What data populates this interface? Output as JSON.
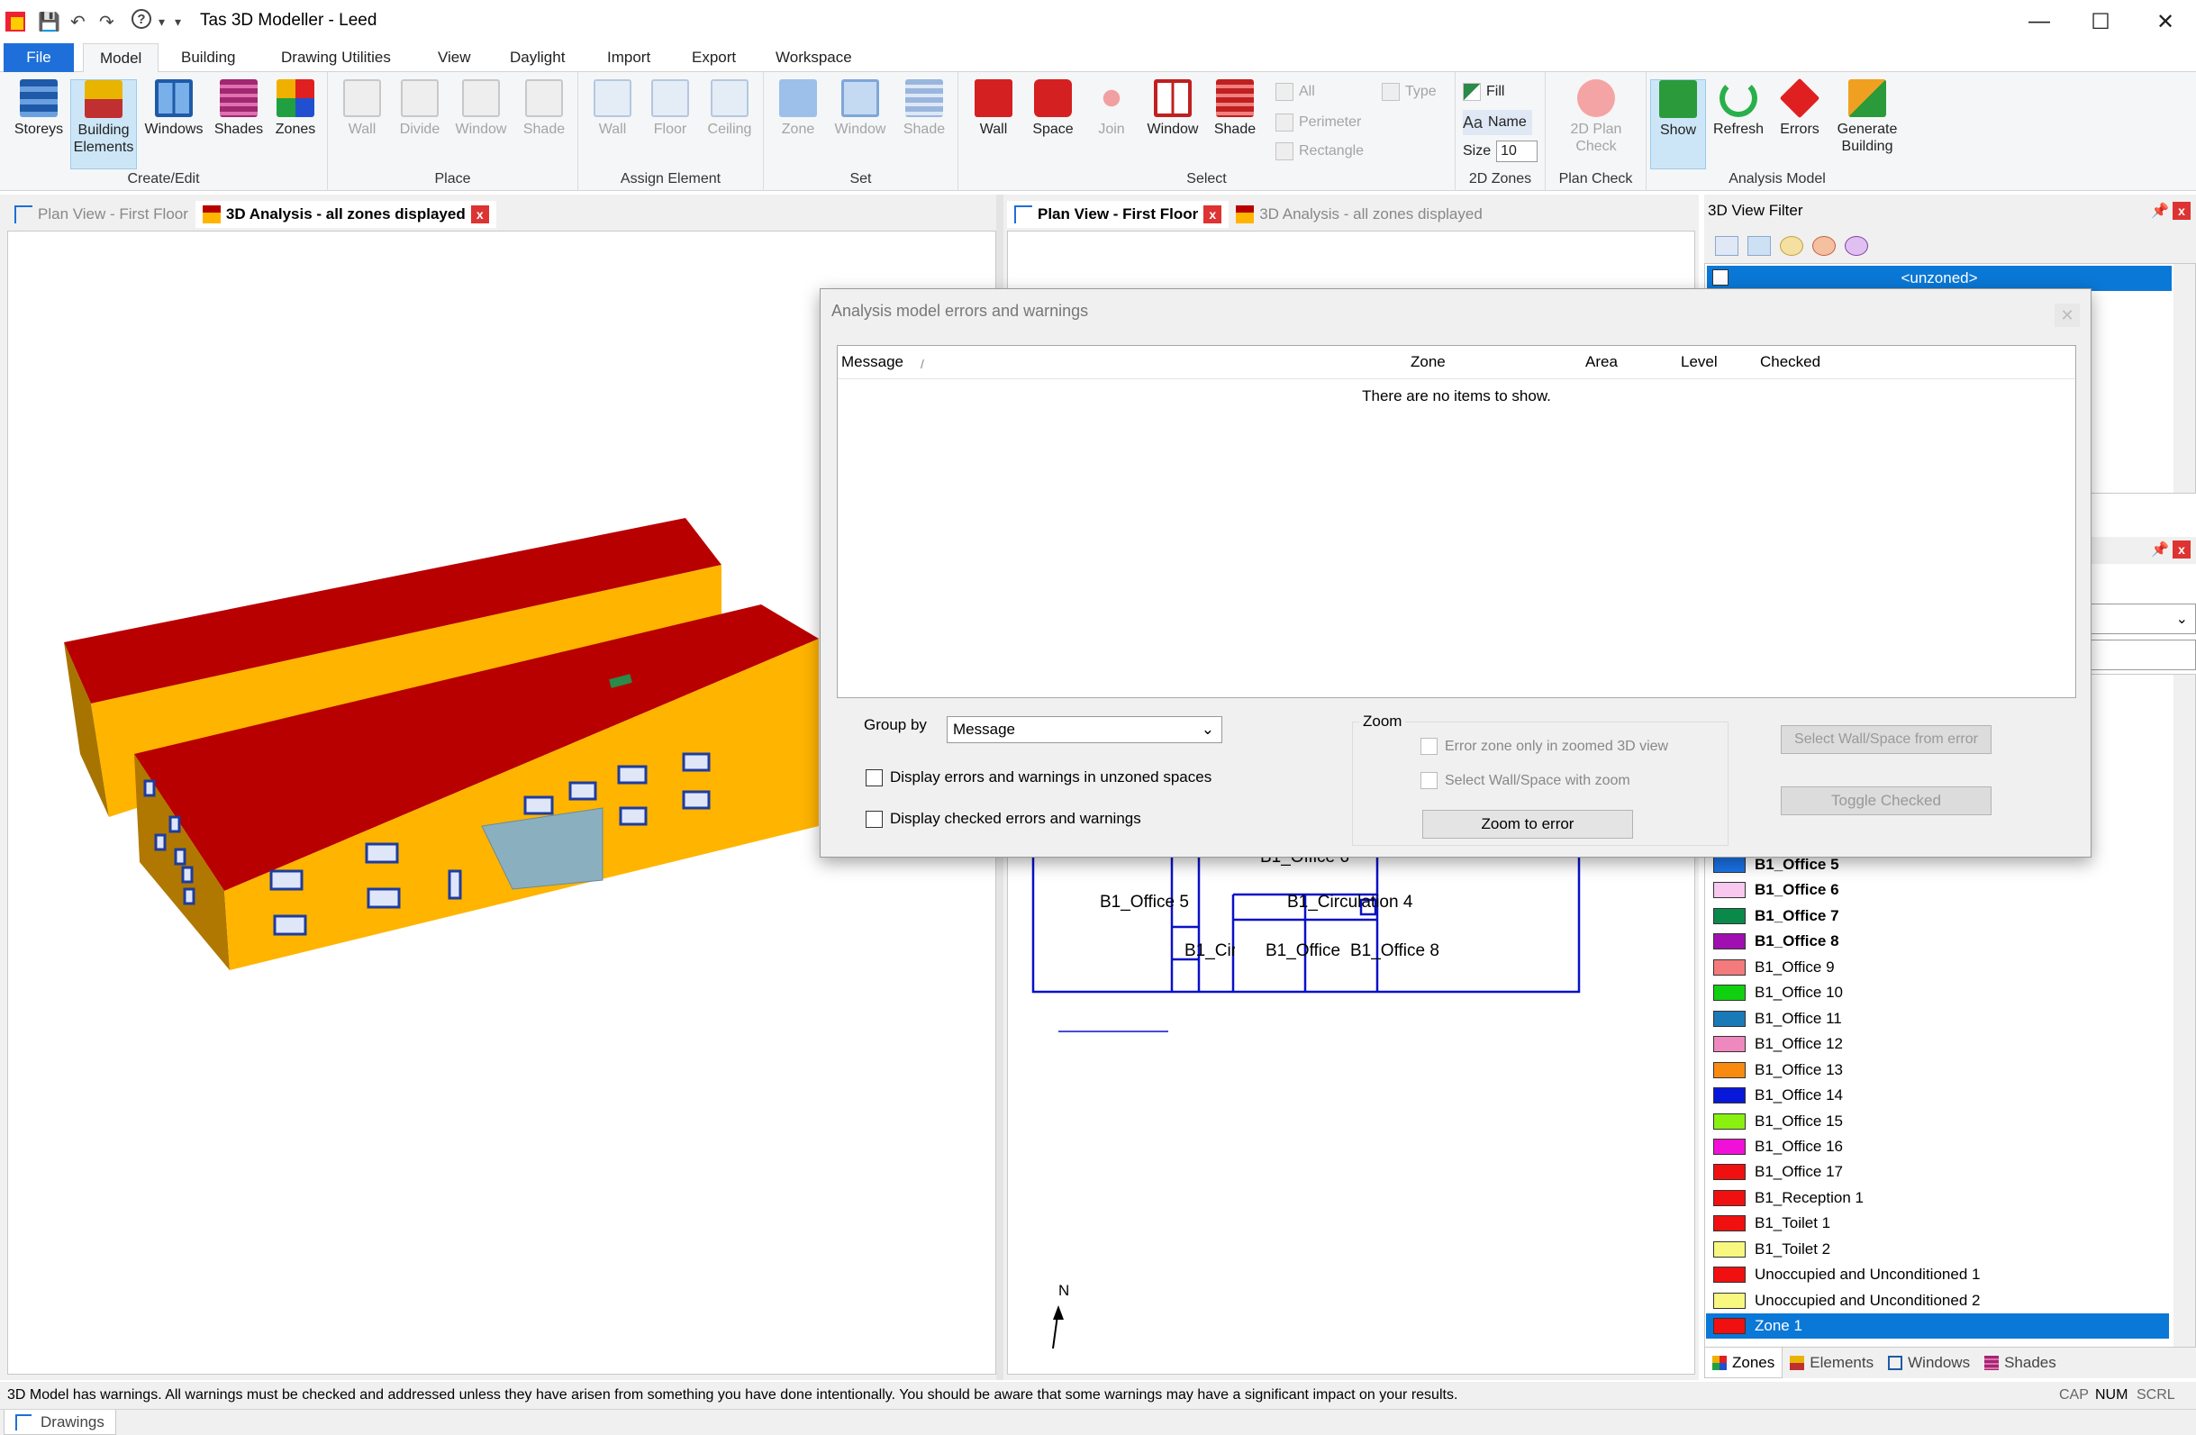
{
  "window": {
    "title": "Tas 3D Modeller - Leed",
    "minimize": "—",
    "maximize": "☐",
    "close": "✕"
  },
  "quick_access": [
    "💾",
    "↶",
    "↷",
    "?",
    "▾",
    "▾"
  ],
  "ribbon_tabs": [
    "File",
    "Model",
    "Building",
    "Drawing Utilities",
    "View",
    "Daylight",
    "Import",
    "Export",
    "Workspace"
  ],
  "groups": {
    "create_edit": {
      "label": "Create/Edit",
      "buttons": [
        "Storeys",
        "Building Elements",
        "Windows",
        "Shades",
        "Zones"
      ]
    },
    "place": {
      "label": "Place",
      "buttons": [
        "Wall",
        "Divide",
        "Window",
        "Shade"
      ]
    },
    "assign": {
      "label": "Assign Element",
      "buttons": [
        "Wall",
        "Floor",
        "Ceiling"
      ]
    },
    "set": {
      "label": "Set",
      "buttons": [
        "Zone",
        "Window",
        "Shade"
      ]
    },
    "select": {
      "label": "Select",
      "buttons": [
        "Wall",
        "Space",
        "Join",
        "Window",
        "Shade"
      ],
      "small": [
        "All",
        "Perimeter",
        "Rectangle",
        "Type"
      ]
    },
    "zones2d": {
      "label": "2D Zones",
      "fill": "Fill",
      "name": "Name",
      "size_label": "Size",
      "size_value": "10"
    },
    "plan_check": {
      "label": "Plan Check",
      "button": "2D Plan Check"
    },
    "analysis": {
      "label": "Analysis Model",
      "buttons": [
        "Show",
        "Refresh",
        "Errors",
        "Generate Building"
      ]
    }
  },
  "left_tabs": {
    "tab1": "Plan View - First Floor",
    "tab2": "3D Analysis - all zones displayed"
  },
  "mid_tabs": {
    "tab1": "Plan View - First Floor",
    "tab2": "3D Analysis - all zones displayed"
  },
  "plan": {
    "labels": [
      "B1_Office 5",
      "B1_Circulation 4",
      "B1_Circula",
      "B1_Office",
      "B1_Office 8",
      "B1_Office 6"
    ],
    "north": "N"
  },
  "filter_panel": {
    "title": "3D View Filter",
    "unzoned": "<unzoned>"
  },
  "zones_panel": {
    "items": [
      {
        "name": "B1_Office 5",
        "color": "#1a73e8",
        "bold": true
      },
      {
        "name": "B1_Office 6",
        "color": "#f8c8ee",
        "bold": true
      },
      {
        "name": "B1_Office 7",
        "color": "#0a8a4a",
        "bold": true
      },
      {
        "name": "B1_Office 8",
        "color": "#a010b0",
        "bold": true
      },
      {
        "name": "B1_Office 9",
        "color": "#f47b7b",
        "bold": false
      },
      {
        "name": "B1_Office 10",
        "color": "#10d010",
        "bold": false
      },
      {
        "name": "B1_Office 11",
        "color": "#1a7ab8",
        "bold": false
      },
      {
        "name": "B1_Office 12",
        "color": "#f088c0",
        "bold": false
      },
      {
        "name": "B1_Office 13",
        "color": "#f88a10",
        "bold": false
      },
      {
        "name": "B1_Office 14",
        "color": "#0818d8",
        "bold": false
      },
      {
        "name": "B1_Office 15",
        "color": "#8af010",
        "bold": false
      },
      {
        "name": "B1_Office 16",
        "color": "#f010d8",
        "bold": false
      },
      {
        "name": "B1_Office 17",
        "color": "#f01010",
        "bold": false
      },
      {
        "name": "B1_Reception 1",
        "color": "#f01010",
        "bold": false
      },
      {
        "name": "B1_Toilet 1",
        "color": "#f01010",
        "bold": false
      },
      {
        "name": "B1_Toilet 2",
        "color": "#f8f880",
        "bold": false
      },
      {
        "name": "Unoccupied and Unconditioned 1",
        "color": "#f01010",
        "bold": false
      },
      {
        "name": "Unoccupied and Unconditioned 2",
        "color": "#f8f880",
        "bold": false
      },
      {
        "name": "Zone 1",
        "color": "#f01010",
        "bold": false
      }
    ],
    "tabs": [
      "Zones",
      "Elements",
      "Windows",
      "Shades"
    ]
  },
  "dialog": {
    "title": "Analysis model errors and warnings",
    "close": "✕",
    "columns": [
      "Message",
      "Zone",
      "Area",
      "Level",
      "Checked"
    ],
    "sort_indicator": "/",
    "empty": "There are no items to show.",
    "group_by_label": "Group by",
    "group_by_value": "Message",
    "chk_unzoned": "Display errors and warnings in unzoned spaces",
    "chk_checked": "Display checked errors and warnings",
    "zoom_label": "Zoom",
    "chk_error_zone": "Error zone only in zoomed 3D view",
    "chk_select_zoom": "Select Wall/Space with zoom",
    "zoom_btn": "Zoom to error",
    "select_btn": "Select Wall/Space from error",
    "toggle_btn": "Toggle Checked"
  },
  "status": {
    "message": "3D Model has warnings. All warnings must be checked and addressed unless they have arisen from something you have done intentionally. You should be aware that some warnings may have a significant impact on your results.",
    "cap": "CAP",
    "num": "NUM",
    "scrl": "SCRL"
  },
  "drawings_tab": "Drawings",
  "colors": {
    "accent": "#1e6fd9",
    "roof": "#b80000",
    "wall": "#ffb400",
    "wall_side": "#b07800",
    "selection": "#0a78d7"
  }
}
